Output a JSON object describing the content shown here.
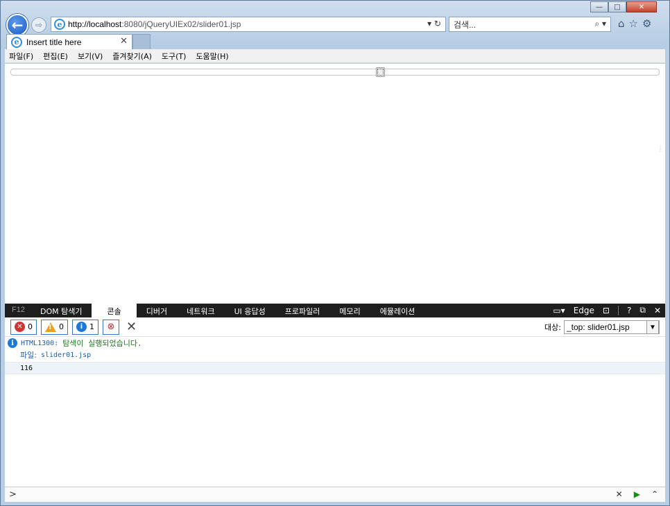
{
  "window": {
    "minimize_glyph": "—",
    "maximize_glyph": "□",
    "close_glyph": "✕"
  },
  "nav": {
    "back_glyph": "←",
    "forward_glyph": "⇨",
    "url_host": "http://localhost",
    "url_rest": ":8080/jQueryUIEx02/slider01.jsp",
    "address_tools": "▾ ↻",
    "search_placeholder": "검색...",
    "search_tools": "⌕ ▾",
    "right_icons": [
      "⌂",
      "☆",
      "⚙"
    ]
  },
  "tab": {
    "title": "Insert title here",
    "close_glyph": "✕"
  },
  "menu": [
    "파일(F)",
    "편집(E)",
    "보기(V)",
    "즐겨찾기(A)",
    "도구(T)",
    "도움말(H)"
  ],
  "slider": {
    "value_fraction": 0.57
  },
  "devtools": {
    "f12_label": "F12",
    "tabs": [
      "DOM 탐색기",
      "콘솔",
      "디버거",
      "네트워크",
      "UI 응답성",
      "프로파일러",
      "메모리",
      "에뮬레이션"
    ],
    "active_tab": "콘솔",
    "mode_label": "Edge",
    "right_icons": [
      "▭▾",
      "⊡",
      "?",
      "⧉",
      "✕"
    ],
    "filters": {
      "errors": "0",
      "warnings": "0",
      "info": "1"
    },
    "target_label": "대상:",
    "target_value": "_top: slider01.jsp",
    "messages": {
      "code": "HTML1300:",
      "text": "탐색이 실행되었습니다.",
      "file_label": "파일:",
      "file_name": "slider01.jsp",
      "log_value": "116"
    },
    "prompt_glyph": ">",
    "input_tools": [
      "✕",
      "▶",
      "⌃"
    ]
  }
}
